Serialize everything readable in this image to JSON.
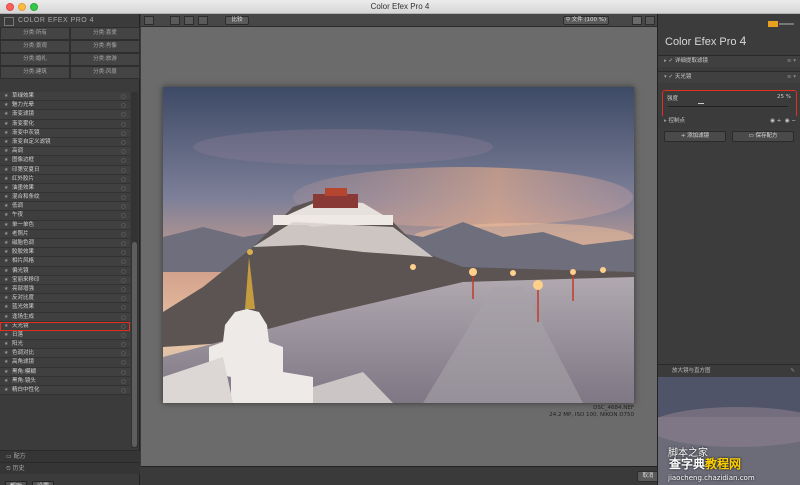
{
  "window": {
    "title": "Color Efex Pro 4"
  },
  "left_panel": {
    "brand": "COLOR EFEX PRO 4",
    "categories": [
      "分类:所有",
      "分类:喜爱",
      "分类:景观",
      "分类:肖像",
      "分类:婚礼",
      "分类:旅游",
      "分类:建筑",
      "分类:风景"
    ],
    "filters": [
      "草绿效果",
      "魅力光晕",
      "渐变滤镜",
      "渐变雾化",
      "渐变中灰镜",
      "渐变自定义滤镜",
      "高调",
      "图像边框",
      "印第安夏日",
      "红外胶片",
      "油墨效果",
      "混合和条纹",
      "低调",
      "午夜",
      "单一单色",
      "老照片",
      "磁胎色调",
      "胶胶效果",
      "相片风格",
      "偏光镜",
      "宝丽来移印",
      "亮部增强",
      "反对比度",
      "蓝光效果",
      "逢场生成",
      "天光镜",
      "日落",
      "阳光",
      "色调对比",
      "高角滤镜",
      "黑角:模糊",
      "黑角:镜头",
      "精白中性化"
    ],
    "highlighted_filter": "天光镜",
    "recipes_label": "配方",
    "history_label": "历史",
    "help_button": "帮助",
    "settings_button": "设置"
  },
  "center": {
    "compare_button": "比较",
    "zoom": "文件 (100 %)",
    "caption_file": "DSC_4684.NEF",
    "caption_meta": "24.2 MP, ISO 100, NIKON D750",
    "cancel_button": "取消"
  },
  "right_panel": {
    "title": "Color Efex Pro",
    "title_version": "4",
    "filter1": "详细提取滤镜",
    "filter2": "天光镜",
    "slider_label": "强度",
    "slider_value": "25 %",
    "slider_fraction": 0.25,
    "control_points": "控制点",
    "add_filter_button": "添加滤镜",
    "save_recipe_button": "保存配方",
    "loupe_label": "放大镜与直方图"
  },
  "watermark": {
    "site_cn": "查字典",
    "site_cn2": "教程网",
    "site_url": "jiaocheng.chazidian.com",
    "logo_text": "脚本之家"
  },
  "colors": {
    "highlight": "#e0301e",
    "panel": "#3b3b3b",
    "canvas": "#6b6b6b"
  }
}
